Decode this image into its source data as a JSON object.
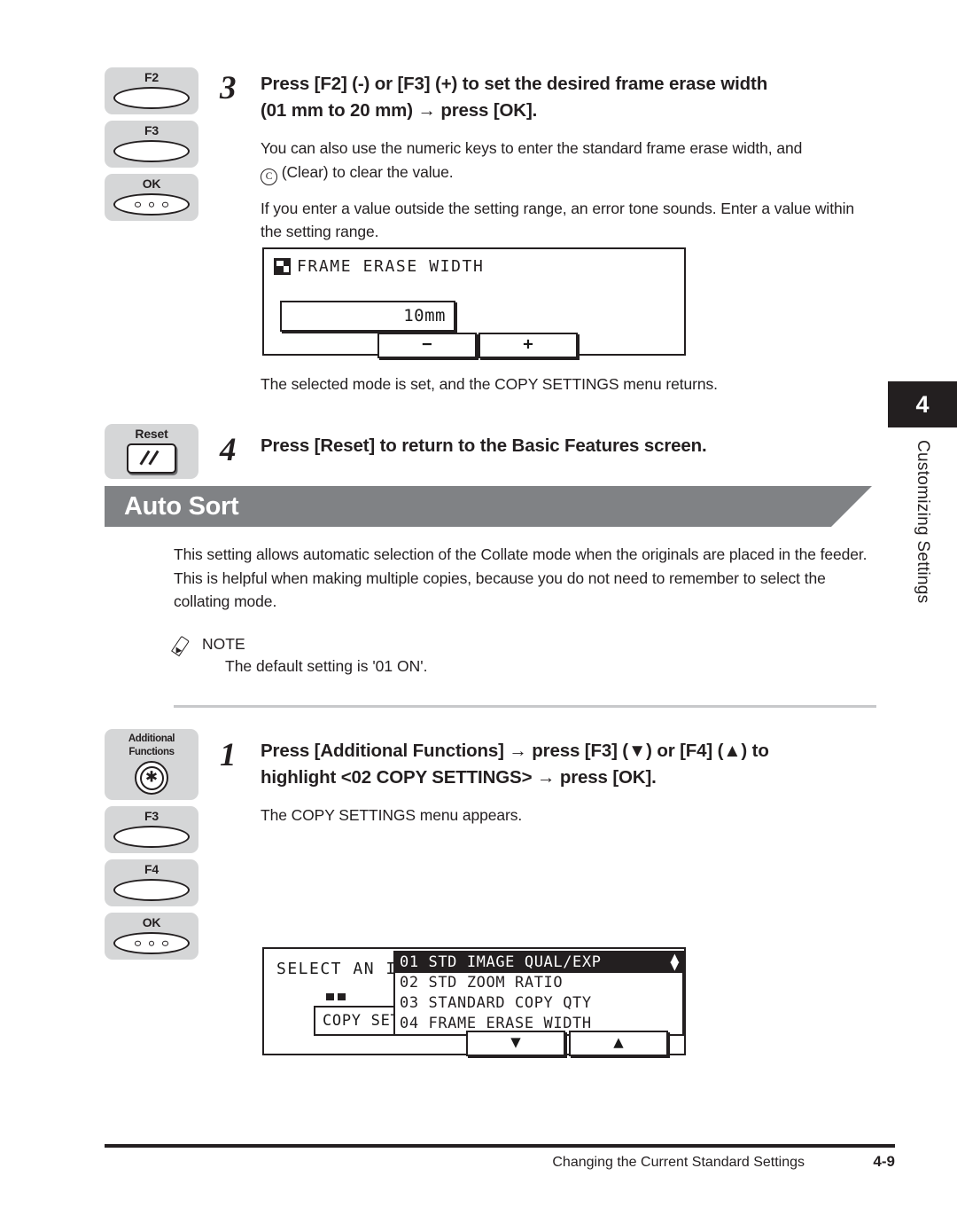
{
  "chapter_tab": {
    "number": "4",
    "label": "Customizing Settings"
  },
  "step3": {
    "number": "3",
    "heading_line1": "Press [F2] (-) or [F3] (+) to set the desired frame erase width",
    "heading_line2": "(01 mm to 20 mm) → press [OK].",
    "para1_before": "You can also use the numeric keys to enter the standard frame erase width, and",
    "clear_key_glyph": "C",
    "para1_after": "(Clear) to clear the value.",
    "para2": "If you enter a value outside the setting range, an error tone sounds. Enter a value within the setting range.",
    "keys": [
      {
        "label": "F2",
        "type": "lens"
      },
      {
        "label": "F3",
        "type": "lens"
      },
      {
        "label": "OK",
        "type": "lens-dots"
      }
    ],
    "lcd": {
      "title": "FRAME ERASE WIDTH",
      "icon": "frame-erase-icon",
      "value": "10mm",
      "softkey_minus": "−",
      "softkey_plus": "+"
    },
    "after_lcd": "The selected mode is set, and the COPY SETTINGS menu returns."
  },
  "step4": {
    "number": "4",
    "heading": "Press [Reset] to return to the Basic Features screen.",
    "keys": [
      {
        "label": "Reset",
        "type": "reset"
      }
    ]
  },
  "section": {
    "title": "Auto Sort",
    "intro": "This setting allows automatic selection of the Collate mode when the originals are placed in the feeder. This is helpful when making multiple copies, because you do not need to remember to select the collating mode.",
    "note_label": "NOTE",
    "note_text": "The default setting is '01 ON'."
  },
  "step1": {
    "number": "1",
    "heading_line1": "Press [Additional Functions] → press [F3] (▼) or [F4] (▲) to",
    "heading_line2": "highlight <02 COPY SETTINGS> → press [OK].",
    "para": "The COPY SETTINGS menu appears.",
    "keys": [
      {
        "label": "Additional Functions",
        "type": "af"
      },
      {
        "label": "F3",
        "type": "lens"
      },
      {
        "label": "F4",
        "type": "lens"
      },
      {
        "label": "OK",
        "type": "lens-dots"
      }
    ],
    "lcd": {
      "prompt": "SELECT AN ITEM",
      "menu_label": "COPY SETTINGS",
      "items": [
        {
          "text": "01 STD IMAGE QUAL/EXP",
          "selected": true
        },
        {
          "text": "02 STD ZOOM RATIO",
          "selected": false
        },
        {
          "text": "03 STANDARD COPY QTY",
          "selected": false
        },
        {
          "text": "04 FRAME ERASE WIDTH",
          "selected": false
        }
      ],
      "scroll_up": "▲",
      "scroll_down": "▼",
      "softkey_down": "▼",
      "softkey_up": "▲"
    }
  },
  "footer": {
    "title": "Changing the Current Standard Settings",
    "page_number": "4-9"
  },
  "colors": {
    "banner": "#808285",
    "key_bg": "#d5d6d7",
    "ink": "#231f20"
  }
}
